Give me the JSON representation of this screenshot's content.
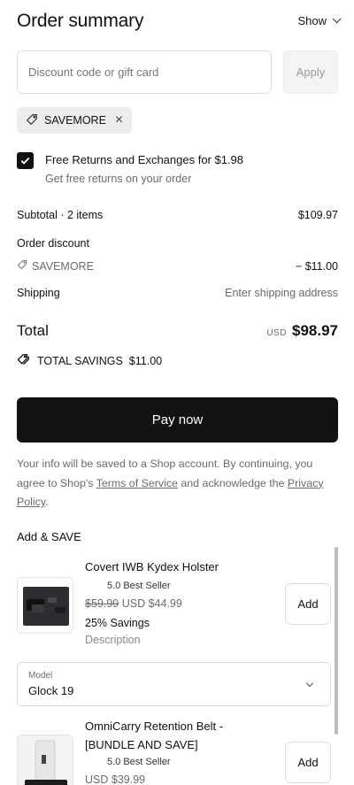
{
  "header": {
    "title": "Order summary",
    "toggle_label": "Show"
  },
  "discount": {
    "placeholder": "Discount code or gift card",
    "apply_label": "Apply",
    "applied_code": "SAVEMORE"
  },
  "free_returns": {
    "checked": true,
    "title": "Free Returns and Exchanges for $1.98",
    "subtitle": "Get free returns on your order"
  },
  "summary": {
    "subtotal_label": "Subtotal · 2 items",
    "subtotal_value": "$109.97",
    "order_discount_label": "Order discount",
    "discount_code": "SAVEMORE",
    "discount_value": "− $11.00",
    "shipping_label": "Shipping",
    "shipping_value": "Enter shipping address",
    "total_label": "Total",
    "currency": "USD",
    "total_value": "$98.97",
    "savings_label": "TOTAL SAVINGS",
    "savings_value": "$11.00"
  },
  "pay_button": "Pay now",
  "legal": {
    "part1": "Your info will be saved to a Shop account. By continuing, you agree to Shop's ",
    "terms_link": "Terms of Service",
    "part2": " and acknowledge the ",
    "privacy_link": "Privacy Policy",
    "part3": "."
  },
  "upsell": {
    "title": "Add & SAVE",
    "products": [
      {
        "name": "Covert IWB Kydex Holster",
        "badge": "5.0 Best Seller",
        "old_price": "$59.99",
        "price": "USD $44.99",
        "savings": "25% Savings",
        "description": "Description",
        "add_label": "Add",
        "variant_label": "Model",
        "variant_value": "Glock 19"
      },
      {
        "name": "OmniCarry Retention Belt - [BUNDLE AND SAVE]",
        "badge": "5.0 Best Seller",
        "price": "USD $39.99",
        "add_label": "Add"
      }
    ]
  },
  "colors": {
    "primary_button": "#121212",
    "muted_text": "#6b6b6b",
    "border": "#dedede"
  }
}
